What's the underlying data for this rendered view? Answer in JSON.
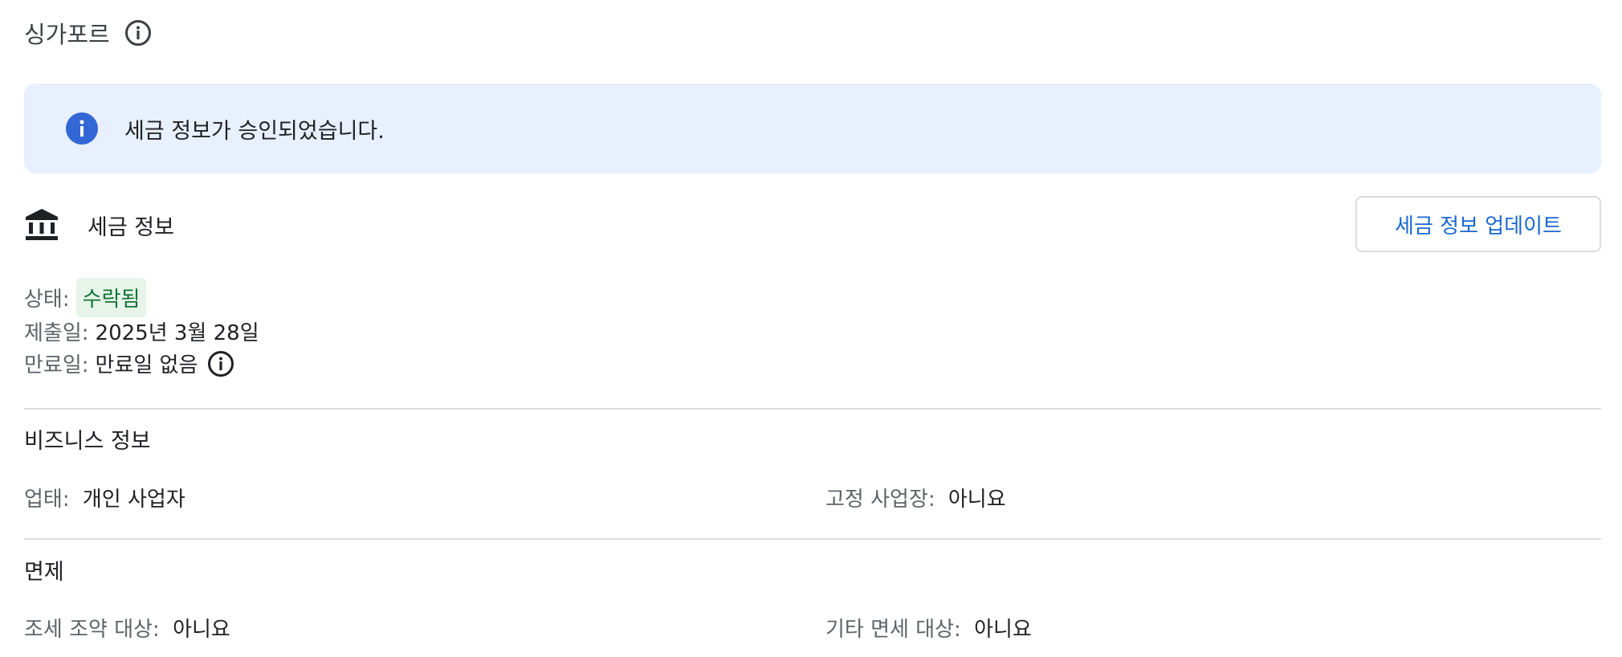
{
  "header": {
    "title": "싱가포르",
    "info_icon": "info-outline-icon"
  },
  "banner": {
    "icon": "info-filled-icon",
    "message": "세금 정보가 승인되었습니다.",
    "background": "#e8f0fe",
    "icon_color": "#3367d6"
  },
  "tax_info": {
    "icon": "bank-icon",
    "label": "세금 정보",
    "update_button": "세금 정보 업데이트",
    "status_label": "상태:",
    "status_value": "수락됨",
    "status_color": "#137333",
    "submitted_label": "제출일:",
    "submitted_value": "2025년 3월 28일",
    "expiry_label": "만료일:",
    "expiry_value": "만료일 없음"
  },
  "business": {
    "title": "비즈니스 정보",
    "type_label": "업태:",
    "type_value": "개인 사업자",
    "fixed_label": "고정 사업장:",
    "fixed_value": "아니요"
  },
  "exemption": {
    "title": "면제",
    "treaty_label": "조세 조약 대상:",
    "treaty_value": "아니요",
    "other_label": "기타 면세 대상:",
    "other_value": "아니요"
  }
}
